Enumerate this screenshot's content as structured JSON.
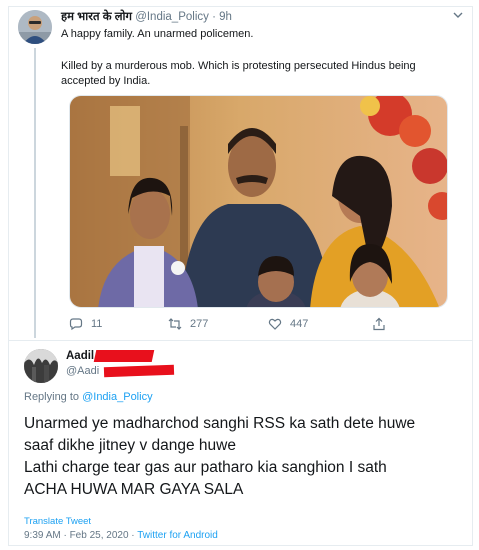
{
  "tweet": {
    "author_name": "हम भारत के लोग",
    "author_handle": "@India_Policy",
    "separator": " · ",
    "time_ago": "9h",
    "line1": "A happy family. An unarmed policemen.",
    "line2": "Killed by a murderous mob. Which is protesting persecuted Hindus being accepted by India.",
    "photo_icon": "family-photo",
    "actions": {
      "replies": "11",
      "retweets": "277",
      "likes": "447"
    }
  },
  "reply": {
    "author_name": "Aadil",
    "author_handle": "@Aadi",
    "replying_prefix": "Replying to ",
    "replying_handle": "@India_Policy",
    "body_lines": [
      "Unarmed ye madharchod sanghi RSS ka sath dete huwe",
      "saaf dikhe jitney v dange huwe",
      "Lathi charge tear gas aur patharo kia sanghion I sath",
      "ACHA HUWA MAR GAYA SALA"
    ],
    "translate_label": "Translate Tweet",
    "timestamp": "9:39 AM · Feb 25, 2020 · ",
    "client": "Twitter for Android"
  },
  "colors": {
    "accent": "#1da1f2",
    "muted": "#657786",
    "redaction": "#e8101c"
  }
}
